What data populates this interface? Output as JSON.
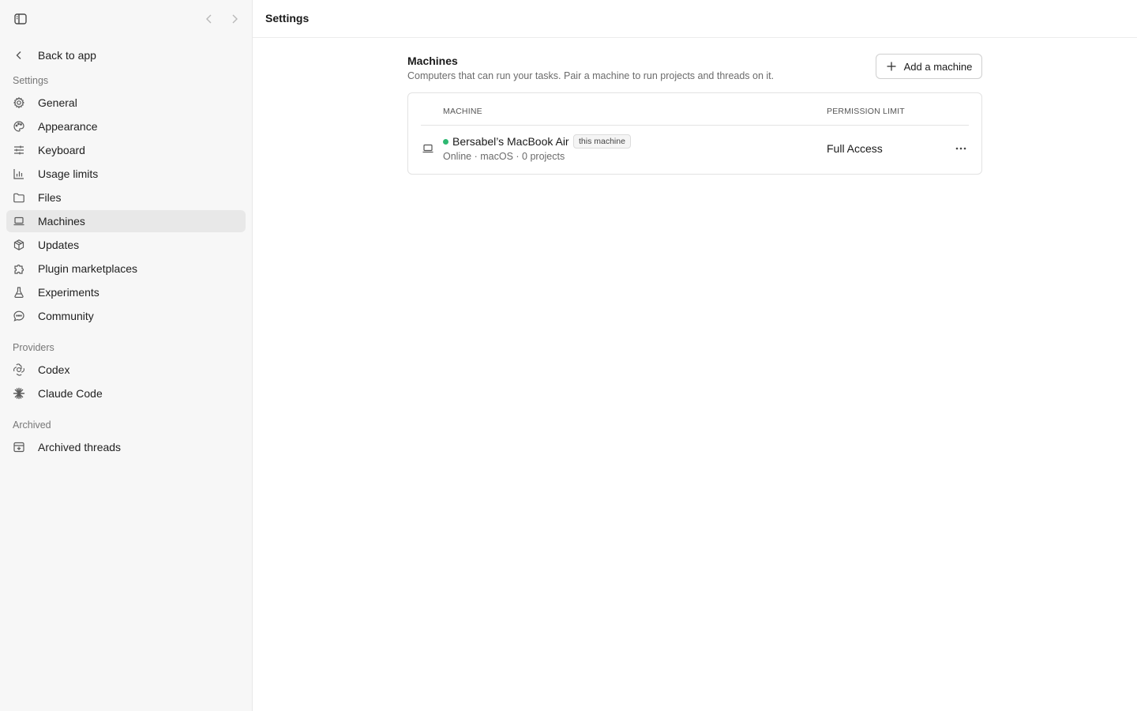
{
  "sidebar": {
    "back_label": "Back to app",
    "sections": {
      "settings": "Settings",
      "providers": "Providers",
      "archived": "Archived"
    },
    "settings_items": [
      {
        "label": "General",
        "icon": "gear-icon"
      },
      {
        "label": "Appearance",
        "icon": "palette-icon"
      },
      {
        "label": "Keyboard",
        "icon": "sliders-icon"
      },
      {
        "label": "Usage limits",
        "icon": "bar-chart-icon"
      },
      {
        "label": "Files",
        "icon": "folder-icon"
      },
      {
        "label": "Machines",
        "icon": "laptop-icon",
        "active": true
      },
      {
        "label": "Updates",
        "icon": "package-icon"
      },
      {
        "label": "Plugin marketplaces",
        "icon": "puzzle-icon"
      },
      {
        "label": "Experiments",
        "icon": "flask-icon"
      },
      {
        "label": "Community",
        "icon": "chat-bubble-icon"
      }
    ],
    "provider_items": [
      {
        "label": "Codex",
        "icon": "openai-icon"
      },
      {
        "label": "Claude Code",
        "icon": "claude-spark-icon"
      }
    ],
    "archived_items": [
      {
        "label": "Archived threads",
        "icon": "archive-icon"
      }
    ]
  },
  "header": {
    "title": "Settings"
  },
  "machines": {
    "title": "Machines",
    "description": "Computers that can run your tasks. Pair a machine to run projects and threads on it.",
    "add_button": "Add a machine",
    "columns": {
      "machine": "MACHINE",
      "permission": "PERMISSION LIMIT"
    },
    "rows": [
      {
        "name": "Bersabel’s MacBook Air",
        "badge": "this machine",
        "status": "Online · macOS · 0 projects",
        "permission": "Full Access",
        "status_color": "#2eb872"
      }
    ]
  }
}
